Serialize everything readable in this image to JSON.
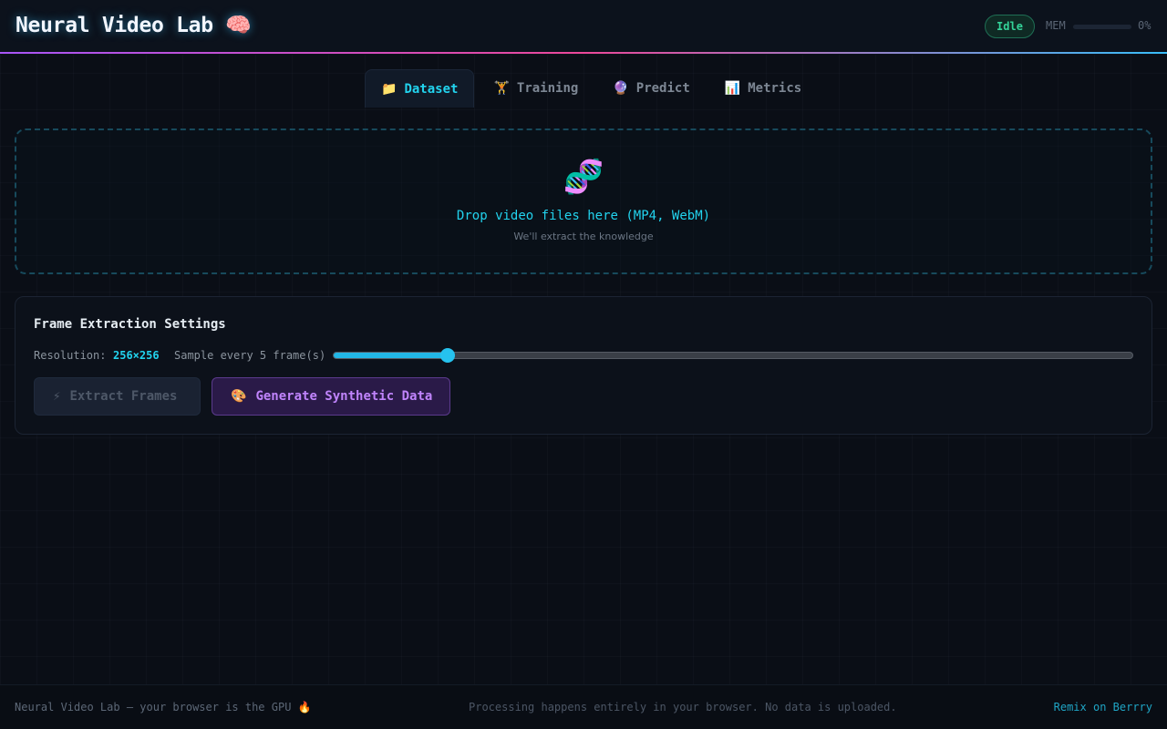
{
  "header": {
    "title": "Neural Video Lab 🧠",
    "status": "Idle",
    "mem_label": "MEM",
    "mem_value": "0%",
    "mem_fraction": 0
  },
  "tabs": [
    {
      "icon": "📁",
      "label": "Dataset",
      "active": true
    },
    {
      "icon": "🏋",
      "label": "Training",
      "active": false
    },
    {
      "icon": "🔮",
      "label": "Predict",
      "active": false
    },
    {
      "icon": "📊",
      "label": "Metrics",
      "active": false
    }
  ],
  "dropzone": {
    "icon": "🧬",
    "title": "Drop video files here (MP4, WebM)",
    "subtitle": "We'll extract the knowledge"
  },
  "settings": {
    "title": "Frame Extraction Settings",
    "resolution_label": "Resolution:",
    "resolution_value": "256×256",
    "sample_label": "Sample every 5 frame(s)",
    "sample_slider_fraction": 0.143,
    "extract_button": {
      "icon": "⚡",
      "label": "Extract Frames"
    },
    "generate_button": {
      "icon": "🎨",
      "label": "Generate Synthetic Data"
    }
  },
  "footer": {
    "left": "Neural Video Lab — your browser is the GPU 🔥",
    "center": "Processing happens entirely in your browser. No data is uploaded.",
    "right": "Remix on Berrry"
  },
  "colors": {
    "accent": "#22d3ee",
    "purple": "#c084fc",
    "status_green": "#34d399"
  }
}
